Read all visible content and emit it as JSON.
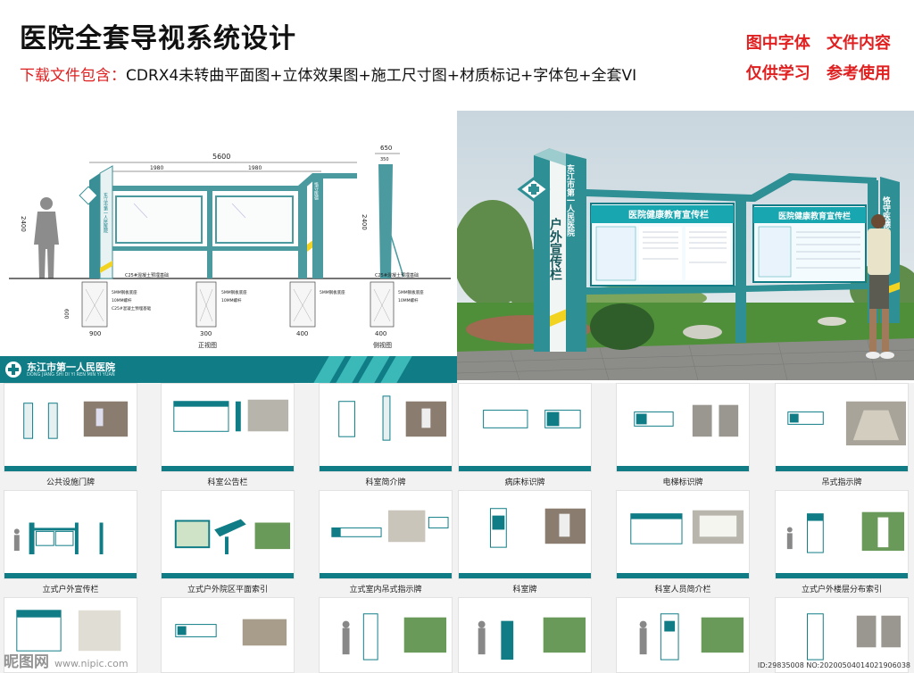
{
  "header": {
    "title": "医院全套导视系统设计",
    "subtitle_lead": "下载文件包含：",
    "subtitle_rest": "CDRX4未转曲平面图+立体效果图+施工尺寸图+材质标记+字体包+全套VI",
    "note_line1": "图中字体   文件内容",
    "note_line2": "仅供学习   参考使用"
  },
  "elevation": {
    "dim_total": "5600",
    "dim_left": "1980",
    "dim_right": "1980",
    "dim_side_top": "650",
    "dim_side_inner": "350",
    "dim_height_left": "2400",
    "dim_height_right": "2400",
    "dim_found_depth": "600",
    "dim_foot_a": "900",
    "dim_foot_b": "300",
    "dim_foot_c": "400",
    "dim_foot_d": "400",
    "label_front": "正视图",
    "label_side": "侧视图",
    "label_concrete": "C25#混凝土预埋基础",
    "note_a": "5MM钢板底座",
    "note_b": "10MM螺杆",
    "note_c": "C25#混凝土预埋基础",
    "pillar_text": "户外宣传栏",
    "pillar_hospital": "东江市第一人民医院"
  },
  "render": {
    "pillar_text": "户外宣传栏",
    "hospital_name": "东江市第一人民医院",
    "board_title_1": "医院健康教育宣传栏",
    "board_title_2": "医院健康教育宣传栏",
    "side_text": "恪守医德"
  },
  "vi": {
    "name": "东江市第一人民医院",
    "pinyin": "DONG JIANG SHI DI YI REN MIN YI YUAN"
  },
  "cards": [
    {
      "caption": "公共设施门牌"
    },
    {
      "caption": "科室公告栏"
    },
    {
      "caption": "科室简介牌"
    },
    {
      "caption": "病床标识牌"
    },
    {
      "caption": "电梯标识牌"
    },
    {
      "caption": "吊式指示牌"
    },
    {
      "caption": "立式户外宣传栏"
    },
    {
      "caption": "立式户外院区平面索引"
    },
    {
      "caption": "立式室内吊式指示牌"
    },
    {
      "caption": "科室牌"
    },
    {
      "caption": "科室人员简介栏"
    },
    {
      "caption": "立式户外楼层分布索引"
    },
    {
      "caption": ""
    },
    {
      "caption": ""
    },
    {
      "caption": ""
    },
    {
      "caption": ""
    },
    {
      "caption": ""
    },
    {
      "caption": ""
    }
  ],
  "watermark": {
    "brand": "昵图网",
    "url": "www.nipic.com",
    "id_text": "ID:29835008 NO:20200504014021906038"
  },
  "colors": {
    "teal": "#0f7c86",
    "teal_light": "#3bb8b8",
    "accent_red": "#e02020",
    "accent_yellow": "#f2d321"
  }
}
